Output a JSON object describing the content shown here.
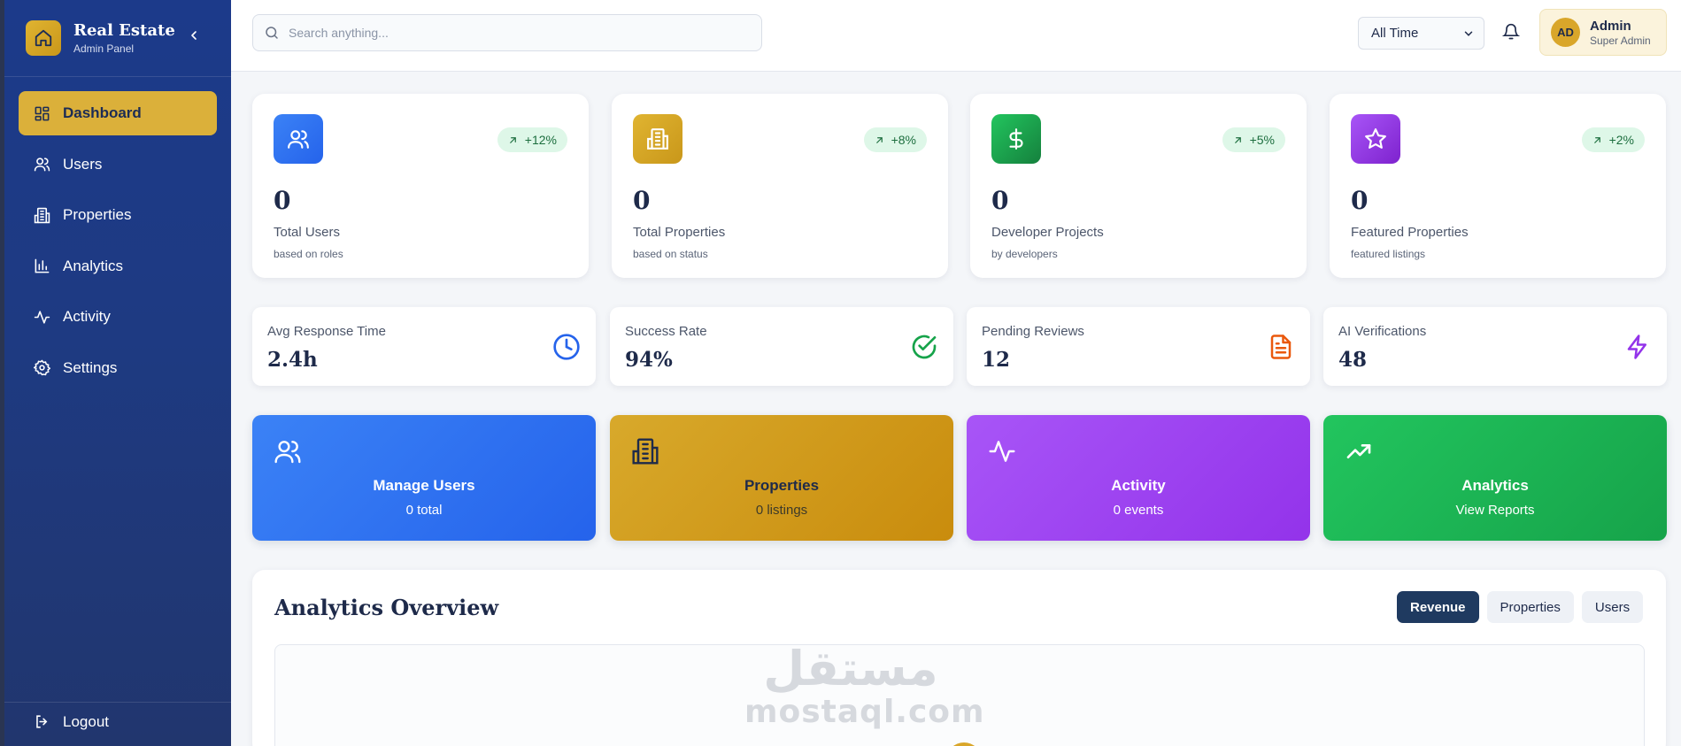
{
  "brand": {
    "title": "Real Estate",
    "subtitle": "Admin Panel"
  },
  "sidebar": {
    "items": [
      {
        "label": "Dashboard",
        "icon": "grid-icon",
        "active": true
      },
      {
        "label": "Users",
        "icon": "users-icon"
      },
      {
        "label": "Properties",
        "icon": "building-icon"
      },
      {
        "label": "Analytics",
        "icon": "bar-chart-icon"
      },
      {
        "label": "Activity",
        "icon": "activity-icon"
      },
      {
        "label": "Settings",
        "icon": "gear-icon"
      }
    ],
    "logout_label": "Logout"
  },
  "header": {
    "search_placeholder": "Search anything...",
    "time_filter": "All Time",
    "user": {
      "initials": "AD",
      "name": "Admin",
      "role": "Super Admin"
    }
  },
  "stats": [
    {
      "value": "0",
      "label": "Total Users",
      "sub": "based on roles",
      "trend": "+12%",
      "color": "#2563eb"
    },
    {
      "value": "0",
      "label": "Total Properties",
      "sub": "based on status",
      "trend": "+8%",
      "color": "#d4a017"
    },
    {
      "value": "0",
      "label": "Developer Projects",
      "sub": "by developers",
      "trend": "+5%",
      "color": "#16a34a"
    },
    {
      "value": "0",
      "label": "Featured Properties",
      "sub": "featured listings",
      "trend": "+2%",
      "color": "#9333ea"
    }
  ],
  "metrics": [
    {
      "label": "Avg Response Time",
      "value": "2.4h",
      "icon": "clock-icon",
      "color": "#2563eb"
    },
    {
      "label": "Success Rate",
      "value": "94%",
      "icon": "check-circle-icon",
      "color": "#16a34a"
    },
    {
      "label": "Pending Reviews",
      "value": "12",
      "icon": "document-icon",
      "color": "#ea580c"
    },
    {
      "label": "AI Verifications",
      "value": "48",
      "icon": "lightning-icon",
      "color": "#9333ea"
    }
  ],
  "actions": [
    {
      "title": "Manage Users",
      "sub": "0 total",
      "icon": "users-icon"
    },
    {
      "title": "Properties",
      "sub": "0 listings",
      "icon": "building-icon"
    },
    {
      "title": "Activity",
      "sub": "0 events",
      "icon": "activity-icon"
    },
    {
      "title": "Analytics",
      "sub": "View Reports",
      "icon": "trending-up-icon"
    }
  ],
  "analytics": {
    "title": "Analytics Overview",
    "tabs": [
      "Revenue",
      "Properties",
      "Users"
    ],
    "active_tab": "Revenue"
  },
  "watermark": {
    "arabic": "مستقل",
    "latin": "mostaql.com"
  }
}
